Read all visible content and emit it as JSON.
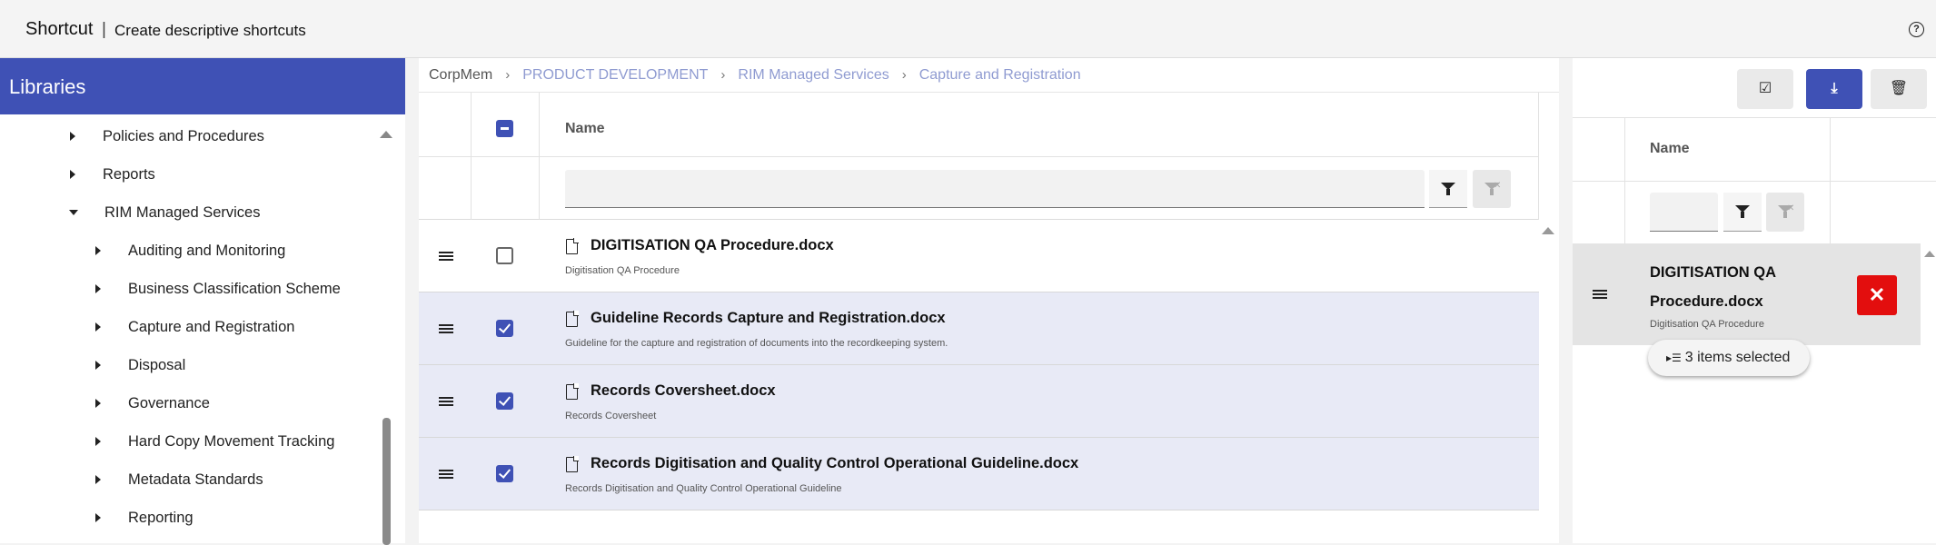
{
  "header": {
    "title": "Shortcut",
    "separator": "|",
    "subtitle": "Create descriptive shortcuts",
    "help_icon": "help-circle-icon"
  },
  "sidebar": {
    "title": "Libraries",
    "items": [
      {
        "label": "Policies and Procedures",
        "level": 1,
        "expanded": false
      },
      {
        "label": "Reports",
        "level": 1,
        "expanded": false
      },
      {
        "label": "RIM Managed Services",
        "level": 1,
        "expanded": true
      },
      {
        "label": "Auditing and Monitoring",
        "level": 2,
        "expanded": false
      },
      {
        "label": "Business Classification Scheme",
        "level": 2,
        "expanded": false
      },
      {
        "label": "Capture and Registration",
        "level": 2,
        "expanded": false
      },
      {
        "label": "Disposal",
        "level": 2,
        "expanded": false
      },
      {
        "label": "Governance",
        "level": 2,
        "expanded": false
      },
      {
        "label": "Hard Copy Movement Tracking",
        "level": 2,
        "expanded": false
      },
      {
        "label": "Metadata Standards",
        "level": 2,
        "expanded": false
      },
      {
        "label": "Reporting",
        "level": 2,
        "expanded": false
      }
    ]
  },
  "breadcrumb": {
    "root": "CorpMem",
    "items": [
      "PRODUCT DEVELOPMENT",
      "RIM Managed Services",
      "Capture and Registration"
    ],
    "separator": "›"
  },
  "grid": {
    "column_name": "Name",
    "filter_value": "",
    "rows": [
      {
        "title": "DIGITISATION QA Procedure.docx",
        "description": "Digitisation QA Procedure",
        "checked": false
      },
      {
        "title": "Guideline Records Capture and Registration.docx",
        "description": "Guideline for the capture and registration of documents into the recordkeeping system.",
        "checked": true
      },
      {
        "title": "Records Coversheet.docx",
        "description": "Records Coversheet",
        "checked": true
      },
      {
        "title": "Records Digitisation and Quality Control Operational Guideline.docx",
        "description": "Records Digitisation and Quality Control Operational Guideline",
        "checked": true
      }
    ]
  },
  "shortcut_panel": {
    "toolbar": {
      "select_all_icon": "☑",
      "download_icon": "⤓",
      "delete_icon": "🗑"
    },
    "column_name": "Name",
    "filter_value": "",
    "item": {
      "title": "DIGITISATION QA Procedure.docx",
      "description": "Digitisation QA Procedure",
      "remove_label": "✕"
    },
    "selection_chip": "3 items selected"
  },
  "colors": {
    "primary": "#3f51b5",
    "selected_row": "#e8eaf6",
    "danger": "#e30e0e",
    "breadcrumb_link": "#8f9bd1"
  }
}
